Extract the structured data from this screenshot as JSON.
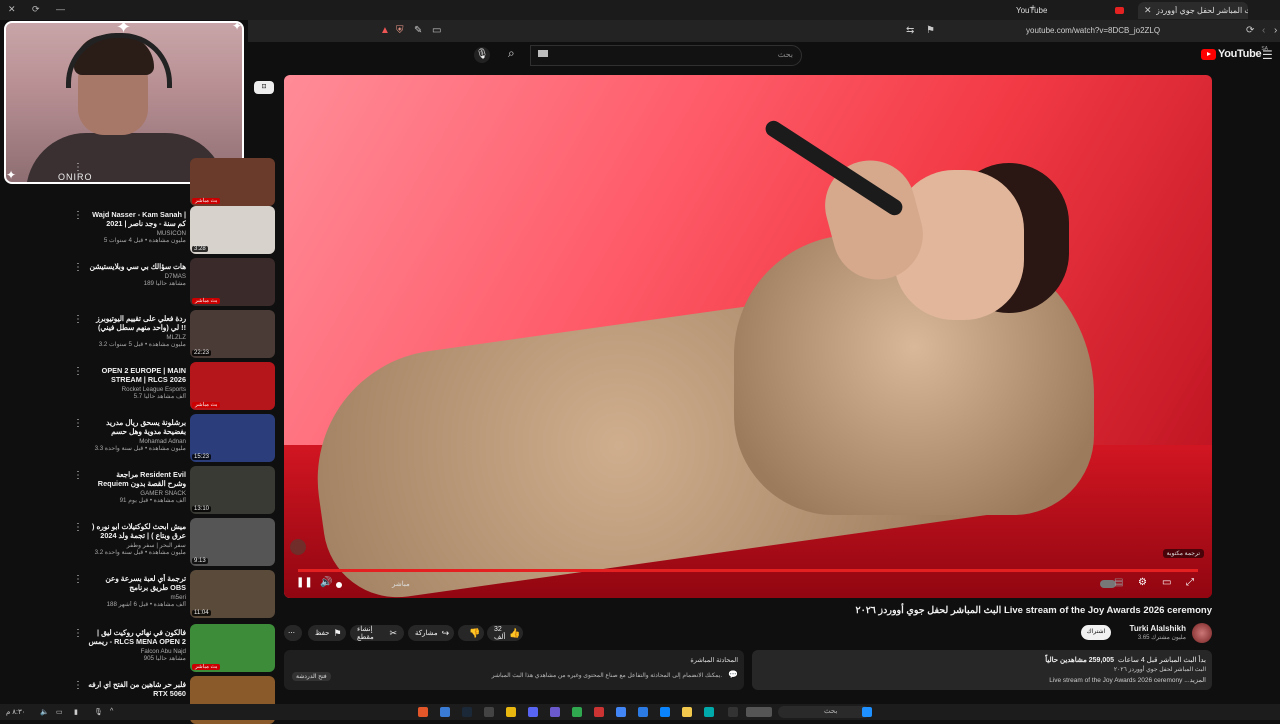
{
  "browser": {
    "active_tab": "البث المباشر لحفل جوي أووردز",
    "other_tab": "YouTube",
    "url": "youtube.com/watch?v=8DCB_jo2ZLQ"
  },
  "header": {
    "search_placeholder": "بحث",
    "logo": "YouTube",
    "logo_country": "SA"
  },
  "webcam": {
    "tag": "ONIRO"
  },
  "sidebar_toggle": "⊡",
  "recommendations": [
    {
      "title": "",
      "channel": "",
      "meta": "",
      "badge": "بث مباشر",
      "badge_type": "live",
      "thumb": "#6a3b2a"
    },
    {
      "title": "Wajd Nasser - Kam Sanah | كم سنة - وجد ناصر | 2021",
      "channel": "MUSICON",
      "meta": "5 مليون مشاهدة • قبل 4 سنوات",
      "badge": "3:28",
      "badge_type": "dur",
      "thumb": "#d8d2cc"
    },
    {
      "title": "هات سؤالك بي سي وبلايستيشن",
      "channel": "D7MAS",
      "meta": "189 مشاهد حالياً",
      "badge": "بث مباشر",
      "badge_type": "live",
      "thumb": "#3b2a2a"
    },
    {
      "title": "ردة فعلي على تقييم اليوتيوبرز لي (واحد منهم سطل فيني) !!",
      "channel": "MLZLZ",
      "meta": "3.2 مليون مشاهدة • قبل 5 سنوات",
      "badge": "22:23",
      "badge_type": "dur",
      "thumb": "#4a3b36"
    },
    {
      "title": "OPEN 2 EUROPE | MAIN STREAM | RLCS 2026",
      "channel": "Rocket League Esports",
      "meta": "5.7 ألف مشاهد حالياً",
      "badge": "بث مباشر",
      "badge_type": "live",
      "thumb": "#b5161c"
    },
    {
      "title": "برشلونة يسحق ريال مدريد بفضيحة مدوية وهل حسم الدوري؟ 😱",
      "channel": "Mohamad Adnan",
      "meta": "3.3 مليون مشاهدة • قبل سنة واحدة",
      "badge": "15:23",
      "badge_type": "dur",
      "thumb": "#2b3d7a"
    },
    {
      "title": "مراجعة Resident Evil Requiem وشرح القصة بدون حرق",
      "channel": "GAMER SNACK",
      "meta": "91 ألف مشاهدة • قبل يوم",
      "badge": "13:10",
      "badge_type": "dur",
      "thumb": "#3a3a34"
    },
    {
      "title": "ميش ابحث لكوكتيلات ابو نوره ( عرق وبتاع ) | تجمة ولد 2024",
      "channel": "سفر البحر | سفر وطفر",
      "meta": "3.2 مليون مشاهدة • قبل سنة واحدة",
      "badge": "9:13",
      "badge_type": "dur",
      "thumb": "#555555"
    },
    {
      "title": "ترجمة أي لعبة بسرعة وعن طريق برنامج OBS",
      "channel": "m5eri",
      "meta": "188 ألف مشاهدة • قبل 6 أشهر",
      "badge": "11:04",
      "badge_type": "dur",
      "thumb": "#5a4a3a"
    },
    {
      "title": "فالكون في نهائي روكيت ليق | ريمس - RLCS MENA OPEN 2 | فالكونز",
      "channel": "Falcon Abu Najd",
      "meta": "905 مشاهد حالياً",
      "badge": "بث مباشر",
      "badge_type": "live",
      "thumb": "#3c8c3a"
    },
    {
      "title": "فلبر حر شاهين من الفتح اي ارفه RTX 5060",
      "channel": "",
      "meta": "",
      "badge": "",
      "badge_type": "none",
      "thumb": "#8a5a2a"
    }
  ],
  "player": {
    "cc_label": "ترجمة مكتوبة",
    "live_label": "مباشر",
    "progress": 1.0
  },
  "video": {
    "title": "البث المباشر لحفل جوي أووردز ٢٠٢٦ Live stream of the Joy Awards 2026 ceremony",
    "channel": "Turki Alalshikh",
    "subs": "3.65 مليون مشترك",
    "subscribe": "اشتراك",
    "likes": "32 ألف",
    "share": "مشاركة",
    "clip": "إنشاء مقطع",
    "save": "حفظ"
  },
  "live_chat": {
    "title": "المحادثة المباشرة",
    "desc": "يمكنك الانضمام إلى المحادثة والتفاعل مع صناع المحتوى وغيره من مشاهدي هذا البث المباشر.",
    "button": "فتح الدردشة"
  },
  "description": {
    "views": "259,005 مشاهدين حالياً",
    "started": "بدأ البث المباشر قبل 4 ساعات",
    "line": "البث المباشر لحفل جوي أووردز ٢٠٢٦",
    "snippet": "Live stream of the Joy Awards 2026 ceremony ...المزيد"
  },
  "taskbar": {
    "search": "بحث",
    "clock": "٨:٣٠ م"
  }
}
